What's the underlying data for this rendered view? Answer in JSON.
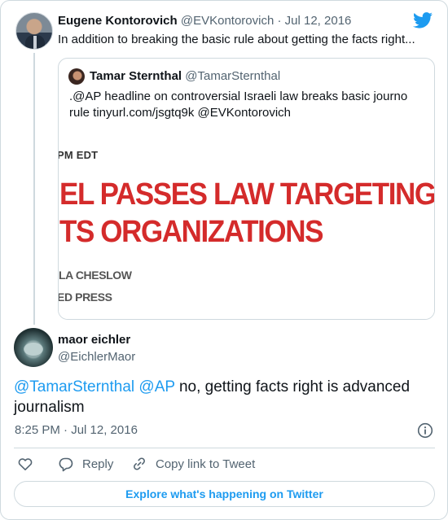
{
  "parent_tweet": {
    "author_name": "Eugene Kontorovich",
    "author_handle": "@EVKontorovich",
    "separator": "·",
    "date": "Jul 12, 2016",
    "text": "In addition to breaking the basic rule about getting the facts right..."
  },
  "quoted_tweet": {
    "author_name": "Tamar Sternthal",
    "author_handle": "@TamarSternthal",
    "text": ".@AP headline on controversial Israeli law breaks basic journo rule tinyurl.com/jsgtq9k @EVKontorovich",
    "image": {
      "timestamp": "PM EDT",
      "headline_line1": "EL PASSES LAW TARGETING HUM",
      "headline_line2": "TS ORGANIZATIONS",
      "byline": "LA CHESLOW",
      "organization": "ED PRESS"
    }
  },
  "main_tweet": {
    "author_name": "maor eichler",
    "author_handle": "@EichlerMaor",
    "mention_1": "@TamarSternthal",
    "mention_2": "@AP",
    "text_rest": " no, getting facts right is advanced journalism",
    "timestamp": "8:25 PM · Jul 12, 2016"
  },
  "actions": {
    "reply_label": "Reply",
    "copy_link_label": "Copy link to Tweet"
  },
  "footer": {
    "explore_label": "Explore what's happening on Twitter"
  },
  "icons": {
    "brand": "twitter-bird-icon",
    "info": "info-icon",
    "like": "heart-icon",
    "reply": "speech-bubble-icon",
    "copy": "link-icon"
  },
  "colors": {
    "accent": "#1d9bf0",
    "headline_red": "#d42b2b",
    "secondary_text": "#536471",
    "border": "#cfd9de"
  }
}
